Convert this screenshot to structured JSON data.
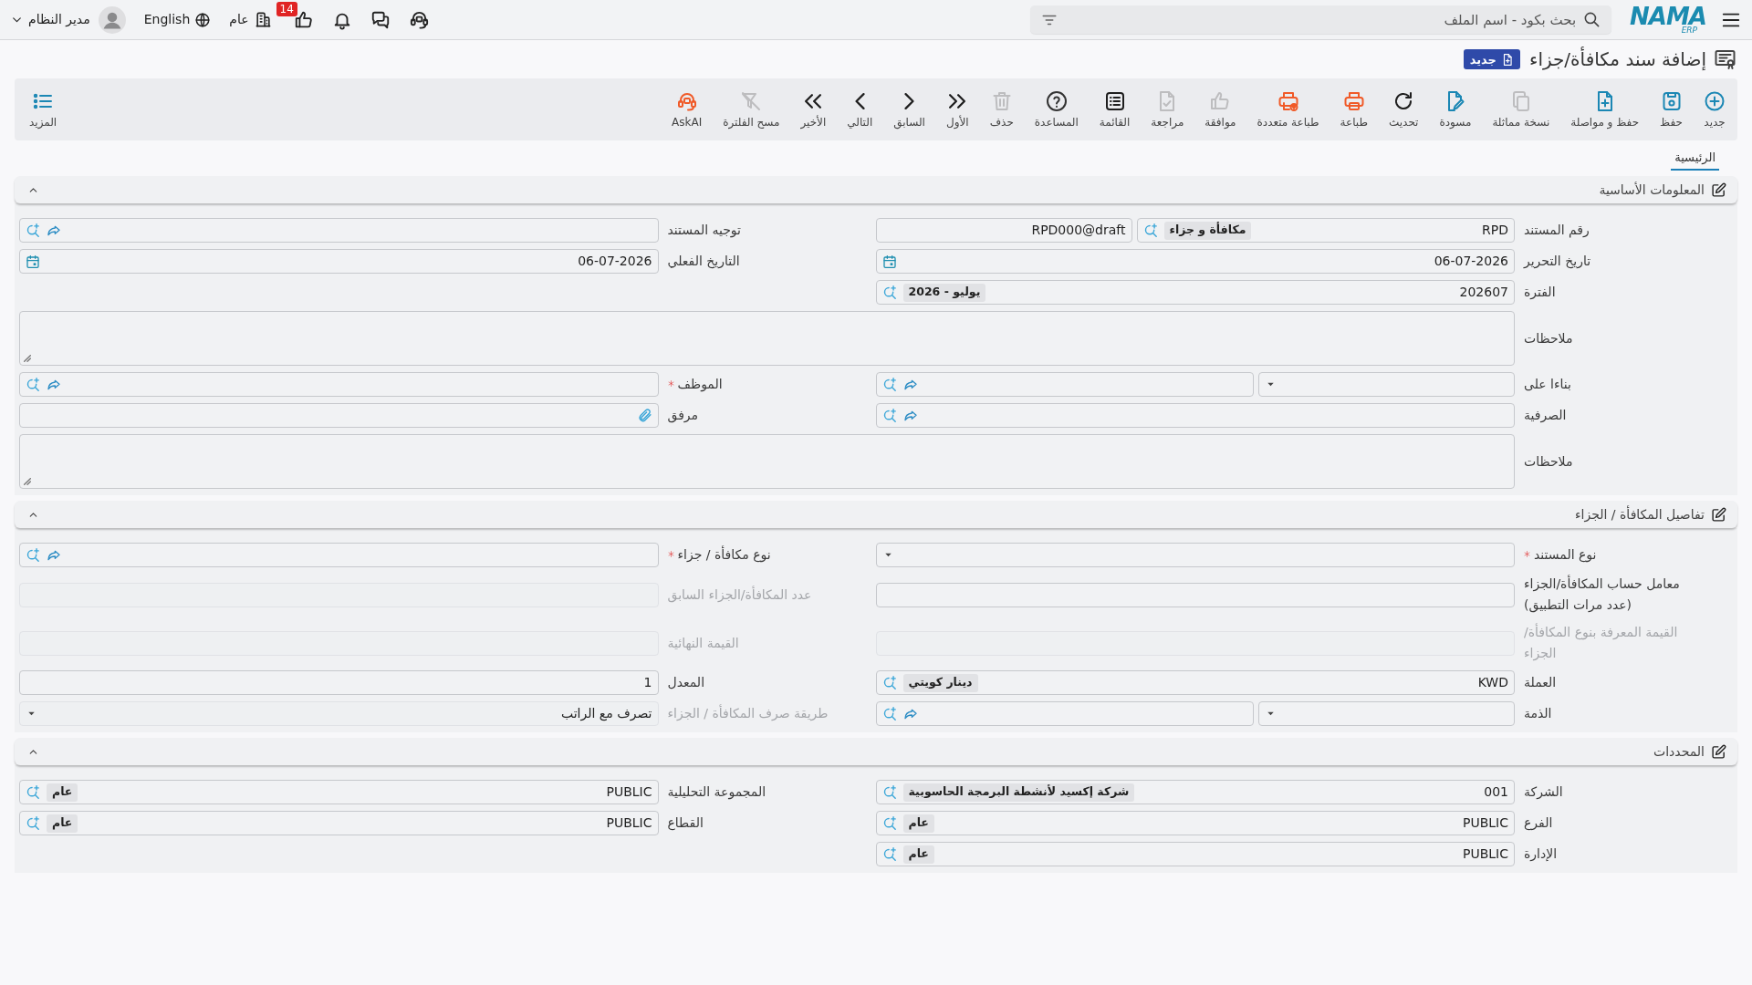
{
  "topbar": {
    "logo": {
      "name": "NAMA",
      "tagline": "ERP"
    },
    "search": {
      "placeholder": "بحث بكود - اسم الملف"
    },
    "approvals_count": "14",
    "company": "عام",
    "language": "English",
    "user": "مدير النظام"
  },
  "page": {
    "title": "إضافة سند مكافأة/جزاء",
    "status": "جديد"
  },
  "toolbar": {
    "items": [
      {
        "kind": "new",
        "label": "جديد",
        "disabled": false
      },
      {
        "kind": "save",
        "label": "حفظ",
        "disabled": false
      },
      {
        "kind": "savenext",
        "label": "حفظ و مواصلة",
        "disabled": false
      },
      {
        "kind": "duplicate",
        "label": "نسخة مماثلة",
        "disabled": true
      },
      {
        "kind": "draft",
        "label": "مسودة",
        "disabled": false
      },
      {
        "kind": "refresh",
        "label": "تحديث",
        "disabled": false
      },
      {
        "kind": "print",
        "label": "طباعة",
        "disabled": false
      },
      {
        "kind": "multiprint",
        "label": "طباعة متعددة",
        "disabled": false
      },
      {
        "kind": "approve",
        "label": "موافقة",
        "disabled": true
      },
      {
        "kind": "review",
        "label": "مراجعة",
        "disabled": true
      },
      {
        "kind": "list",
        "label": "القائمة",
        "disabled": false
      },
      {
        "kind": "help",
        "label": "المساعدة",
        "disabled": false
      },
      {
        "kind": "delete",
        "label": "حذف",
        "disabled": true
      },
      {
        "kind": "first",
        "label": "الأول",
        "disabled": false
      },
      {
        "kind": "previous",
        "label": "السابق",
        "disabled": false
      },
      {
        "kind": "next",
        "label": "التالي",
        "disabled": false
      },
      {
        "kind": "last",
        "label": "الأخير",
        "disabled": false
      },
      {
        "kind": "clearfilter",
        "label": "مسح الفلترة",
        "disabled": true
      },
      {
        "kind": "ai",
        "label": "AskAI",
        "disabled": false
      }
    ],
    "more": {
      "label": "المزيد"
    }
  },
  "tabs": [
    {
      "label": "الرئيسية",
      "selected": true
    }
  ],
  "sections": [
    {
      "title": "المعلومات الأساسية",
      "expanded": true,
      "rows": [
        [
          {
            "label": "رقم المستند",
            "required": false,
            "disabled": false,
            "inputs": [
              {
                "kind": "lookup",
                "value": "RPD",
                "tag": "مكافأة و جزاء"
              },
              {
                "kind": "text",
                "value": "RPD000@draft"
              }
            ]
          },
          {
            "label": "توجيه المستند",
            "required": false,
            "disabled": false,
            "inputs": [
              {
                "kind": "lookup"
              }
            ]
          }
        ],
        [
          {
            "label": "تاريخ التحرير",
            "required": false,
            "disabled": false,
            "inputs": [
              {
                "kind": "date",
                "value": "06-07-2026"
              }
            ]
          },
          {
            "label": "التاريخ الفعلي",
            "required": false,
            "disabled": false,
            "inputs": [
              {
                "kind": "date",
                "value": "06-07-2026"
              }
            ]
          }
        ],
        [
          {
            "label": "الفترة",
            "required": false,
            "disabled": false,
            "inputs": [
              {
                "kind": "lookup",
                "value": "202607",
                "tag": "يوليو - 2026"
              }
            ]
          }
        ],
        [
          {
            "label": "ملاحظات",
            "required": false,
            "disabled": false,
            "inputs": [
              {
                "kind": "textarea"
              }
            ]
          }
        ],
        [
          {
            "label": "بناءا على",
            "required": false,
            "disabled": false,
            "inputs": [
              {
                "kind": "select"
              },
              {
                "kind": "lookup"
              }
            ]
          },
          {
            "label": "الموظف",
            "required": true,
            "disabled": false,
            "inputs": [
              {
                "kind": "lookup"
              }
            ]
          }
        ],
        [
          {
            "label": "الصرفية",
            "required": false,
            "disabled": false,
            "inputs": [
              {
                "kind": "lookup"
              }
            ]
          },
          {
            "label": "مرفق",
            "required": false,
            "disabled": false,
            "inputs": [
              {
                "kind": "attachment"
              }
            ]
          }
        ],
        [
          {
            "label": "ملاحظات",
            "required": false,
            "disabled": false,
            "inputs": [
              {
                "kind": "textarea"
              }
            ]
          }
        ]
      ]
    },
    {
      "title": "تفاصيل المكافأة / الجزاء",
      "expanded": true,
      "rows": [
        [
          {
            "label": "نوع المستند",
            "required": true,
            "disabled": false,
            "inputs": [
              {
                "kind": "select"
              }
            ]
          },
          {
            "label": "نوع مكافأة / جزاء",
            "required": true,
            "disabled": false,
            "inputs": [
              {
                "kind": "lookup"
              }
            ]
          }
        ],
        [
          {
            "label": "معامل حساب المكافأة/الجزاء (عدد مرات التطبيق)",
            "required": false,
            "disabled": false,
            "inputs": [
              {
                "kind": "text"
              }
            ]
          },
          {
            "label": "عدد المكافأة/الجزاء السابق",
            "required": false,
            "disabled": true,
            "inputs": [
              {
                "kind": "text"
              }
            ]
          }
        ],
        [
          {
            "label": "القيمة المعرفة بنوع المكافأة/ الجزاء",
            "required": false,
            "disabled": true,
            "inputs": [
              {
                "kind": "text"
              }
            ]
          },
          {
            "label": "القيمة النهائية",
            "required": false,
            "disabled": true,
            "inputs": [
              {
                "kind": "text"
              }
            ]
          }
        ],
        [
          {
            "label": "العملة",
            "required": false,
            "disabled": false,
            "inputs": [
              {
                "kind": "lookup",
                "value": "KWD",
                "tag": "دينار كويتي"
              }
            ]
          },
          {
            "label": "المعدل",
            "required": false,
            "disabled": false,
            "inputs": [
              {
                "kind": "text",
                "value": "1"
              }
            ]
          }
        ],
        [
          {
            "label": "الذمة",
            "required": false,
            "disabled": false,
            "inputs": [
              {
                "kind": "select"
              },
              {
                "kind": "lookup"
              }
            ]
          },
          {
            "label": "طريقة صرف المكافأة / الجزاء",
            "required": false,
            "disabled": true,
            "inputs": [
              {
                "kind": "select",
                "value": "تصرف مع الراتب"
              }
            ]
          }
        ]
      ]
    },
    {
      "title": "المحددات",
      "expanded": true,
      "rows": [
        [
          {
            "label": "الشركة",
            "required": false,
            "disabled": false,
            "inputs": [
              {
                "kind": "lookup",
                "value": "001",
                "tag": "شركة إكسيد لأنشطة البرمجة الحاسوبية"
              }
            ]
          },
          {
            "label": "المجموعة التحليلية",
            "required": false,
            "disabled": false,
            "inputs": [
              {
                "kind": "lookup",
                "value": "PUBLIC",
                "tag": "عام"
              }
            ]
          }
        ],
        [
          {
            "label": "الفرع",
            "required": false,
            "disabled": false,
            "inputs": [
              {
                "kind": "lookup",
                "value": "PUBLIC",
                "tag": "عام"
              }
            ]
          },
          {
            "label": "القطاع",
            "required": false,
            "disabled": false,
            "inputs": [
              {
                "kind": "lookup",
                "value": "PUBLIC",
                "tag": "عام"
              }
            ]
          }
        ],
        [
          {
            "label": "الإدارة",
            "required": false,
            "disabled": false,
            "inputs": [
              {
                "kind": "lookup",
                "value": "PUBLIC",
                "tag": "عام"
              }
            ]
          }
        ]
      ]
    }
  ]
}
